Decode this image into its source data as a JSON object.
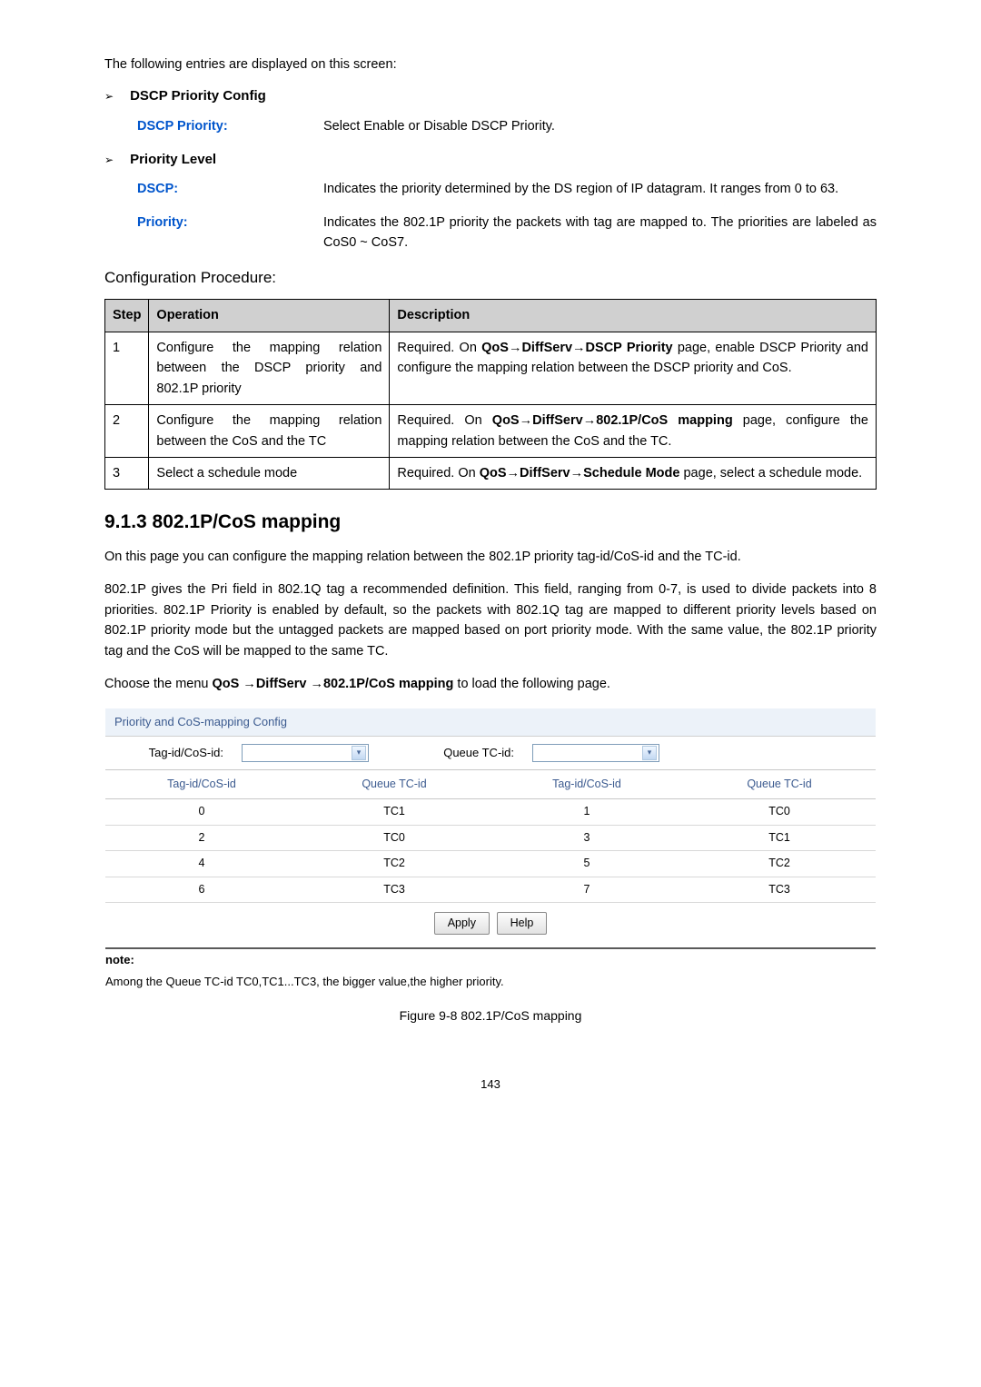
{
  "intro": "The following entries are displayed on this screen:",
  "sections": [
    {
      "title": "DSCP Priority Config",
      "items": [
        {
          "label": "DSCP Priority:",
          "text": "Select Enable or Disable DSCP Priority."
        }
      ]
    },
    {
      "title": "Priority Level",
      "items": [
        {
          "label": "DSCP:",
          "text": "Indicates the priority determined by the DS region of IP datagram. It ranges from 0 to 63."
        },
        {
          "label": "Priority:",
          "text": "Indicates the 802.1P priority the packets with tag are mapped to. The priorities are labeled as CoS0 ~ CoS7."
        }
      ]
    }
  ],
  "config_procedure_title": "Configuration Procedure:",
  "proc_headers": {
    "step": "Step",
    "operation": "Operation",
    "description": "Description"
  },
  "proc_rows": [
    {
      "step": "1",
      "operation": "Configure the mapping relation between the DSCP priority and 802.1P priority",
      "desc_prefix": "Required. On ",
      "desc_bold": "QoS→DiffServ→DSCP Priority",
      "desc_suffix": " page, enable DSCP Priority and configure the mapping relation between the DSCP priority and CoS."
    },
    {
      "step": "2",
      "operation": "Configure the mapping relation between the CoS and the TC",
      "desc_prefix": "Required. On ",
      "desc_bold": "QoS→DiffServ→802.1P/CoS mapping",
      "desc_suffix": " page, configure the mapping relation between the CoS and the TC."
    },
    {
      "step": "3",
      "operation": "Select a schedule mode",
      "desc_prefix": "Required. On ",
      "desc_bold": "QoS→DiffServ→Schedule Mode",
      "desc_suffix": " page, select a schedule mode."
    }
  ],
  "heading_913": "9.1.3 802.1P/CoS mapping",
  "para1": "On this page you can configure the mapping relation between the 802.1P priority tag-id/CoS-id and the TC-id.",
  "para2": "802.1P gives the Pri field in 802.1Q tag a recommended definition. This field, ranging from 0-7, is used to divide packets into 8 priorities. 802.1P Priority is enabled by default, so the packets with 802.1Q tag are mapped to different priority levels based on 802.1P priority mode but the untagged packets are mapped based on port priority mode. With the same value, the 802.1P priority tag and the CoS will be mapped to the same TC.",
  "para3_pre": "Choose the menu ",
  "para3_bold": "QoS →DiffServ →802.1P/CoS mapping",
  "para3_post": " to load the following page.",
  "panel": {
    "header": "Priority and CoS-mapping Config",
    "sel1_label": "Tag-id/CoS-id:",
    "sel2_label": "Queue TC-id:",
    "cols": [
      "Tag-id/CoS-id",
      "Queue TC-id",
      "Tag-id/CoS-id",
      "Queue TC-id"
    ],
    "rows": [
      [
        "0",
        "TC1",
        "1",
        "TC0"
      ],
      [
        "2",
        "TC0",
        "3",
        "TC1"
      ],
      [
        "4",
        "TC2",
        "5",
        "TC2"
      ],
      [
        "6",
        "TC3",
        "7",
        "TC3"
      ]
    ],
    "buttons": [
      "Apply",
      "Help"
    ]
  },
  "note_label": "note:",
  "note_text": "Among the Queue TC-id TC0,TC1...TC3, the bigger value,the higher priority.",
  "figure_caption": "Figure 9-8 802.1P/CoS mapping",
  "page_no": "143"
}
